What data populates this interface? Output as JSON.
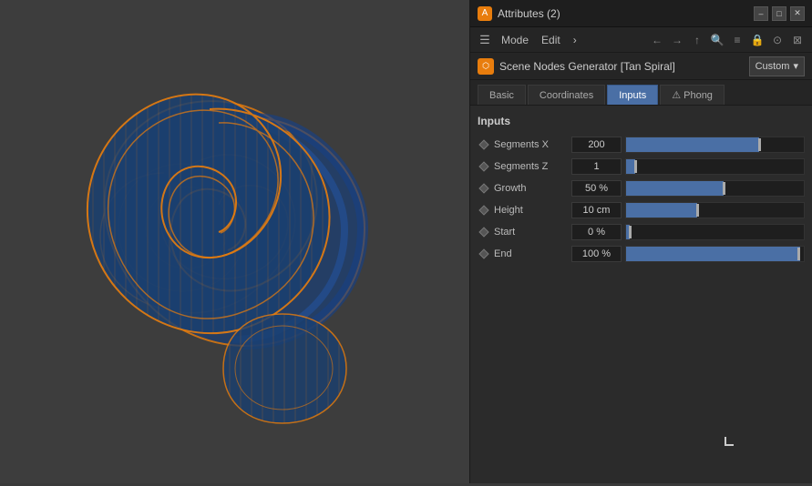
{
  "titleBar": {
    "title": "Attributes (2)",
    "icon": "A",
    "minimizeLabel": "–",
    "maximizeLabel": "□",
    "closeLabel": "✕"
  },
  "menuBar": {
    "items": [
      "Mode",
      "Edit",
      "›"
    ],
    "navIcons": [
      "←",
      "→",
      "↑",
      "🔍",
      "≡",
      "🔒",
      "⊙",
      "⊠"
    ]
  },
  "objectBar": {
    "objectName": "Scene Nodes Generator [Tan Spiral]",
    "preset": "Custom",
    "icon": "⬡"
  },
  "tabs": [
    {
      "id": "basic",
      "label": "Basic",
      "active": false
    },
    {
      "id": "coordinates",
      "label": "Coordinates",
      "active": false
    },
    {
      "id": "inputs",
      "label": "Inputs",
      "active": true
    },
    {
      "id": "phong",
      "label": "⚠ Phong",
      "active": false
    }
  ],
  "inputs": {
    "sectionTitle": "Inputs",
    "params": [
      {
        "name": "Segments X",
        "value": "200",
        "fillPct": 75
      },
      {
        "name": "Segments Z",
        "value": "1",
        "fillPct": 5
      },
      {
        "name": "Growth",
        "value": "50 %",
        "fillPct": 55
      },
      {
        "name": "Height",
        "value": "10 cm",
        "fillPct": 40
      },
      {
        "name": "Start",
        "value": "0 %",
        "fillPct": 2
      },
      {
        "name": "End",
        "value": "100 %",
        "fillPct": 98
      }
    ]
  },
  "colors": {
    "accent": "#4a6fa5",
    "orange": "#e87d0d",
    "sliderFill": "#4a6fa5"
  }
}
